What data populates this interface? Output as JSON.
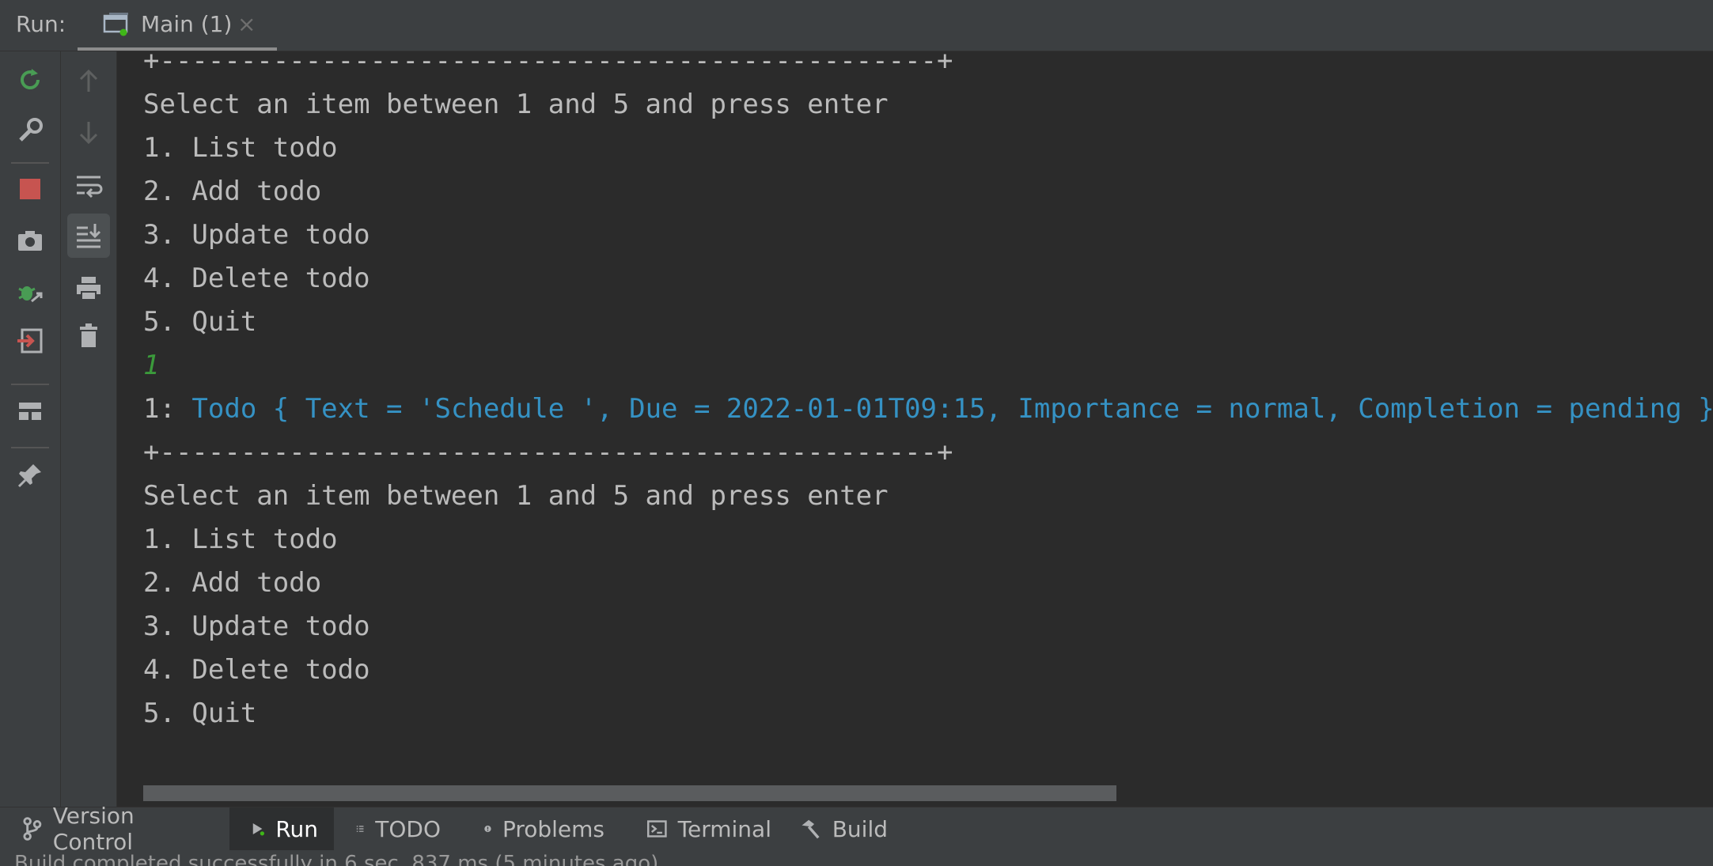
{
  "header": {
    "run_label": "Run:",
    "tab_title": "Main (1)",
    "tab_close": "×"
  },
  "toolbar_left": {
    "icons": [
      "rerun-icon",
      "wrench-icon",
      "stop-icon",
      "camera-icon",
      "debug-icon",
      "exit-icon",
      "layout-icon",
      "pin-icon"
    ]
  },
  "toolbar_secondary": {
    "icons": [
      "up-arrow-icon",
      "down-arrow-icon",
      "soft-wrap-icon",
      "scroll-to-end-icon",
      "print-icon",
      "trash-icon"
    ]
  },
  "console": {
    "lines": [
      "+------------------------------------------------+",
      "Select an item between 1 and 5 and press enter",
      "1. List todo",
      "2. Add todo",
      "3. Update todo",
      "4. Delete todo",
      "5. Quit",
      "1",
      "1: ",
      "+------------------------------------------------+",
      "Select an item between 1 and 5 and press enter",
      "1. List todo",
      "2. Add todo",
      "3. Update todo",
      "4. Delete todo",
      "5. Quit"
    ],
    "todo_text": "Todo { Text = 'Schedule ', Due = 2022-01-01T09:15, Importance = normal, Completion = pending }",
    "user_input_color": "#3b9a3b",
    "highlight_color": "#3592c4"
  },
  "bottom_tabs": [
    {
      "label": "Version Control",
      "icon": "branch-icon"
    },
    {
      "label": "Run",
      "icon": "play-icon",
      "active": true
    },
    {
      "label": "TODO",
      "icon": "list-icon"
    },
    {
      "label": "Problems",
      "icon": "warning-icon"
    },
    {
      "label": "Terminal",
      "icon": "terminal-icon"
    },
    {
      "label": "Build",
      "icon": "hammer-icon"
    }
  ],
  "status": {
    "text": "Build completed successfully in 6 sec, 837 ms (5 minutes ago)"
  }
}
